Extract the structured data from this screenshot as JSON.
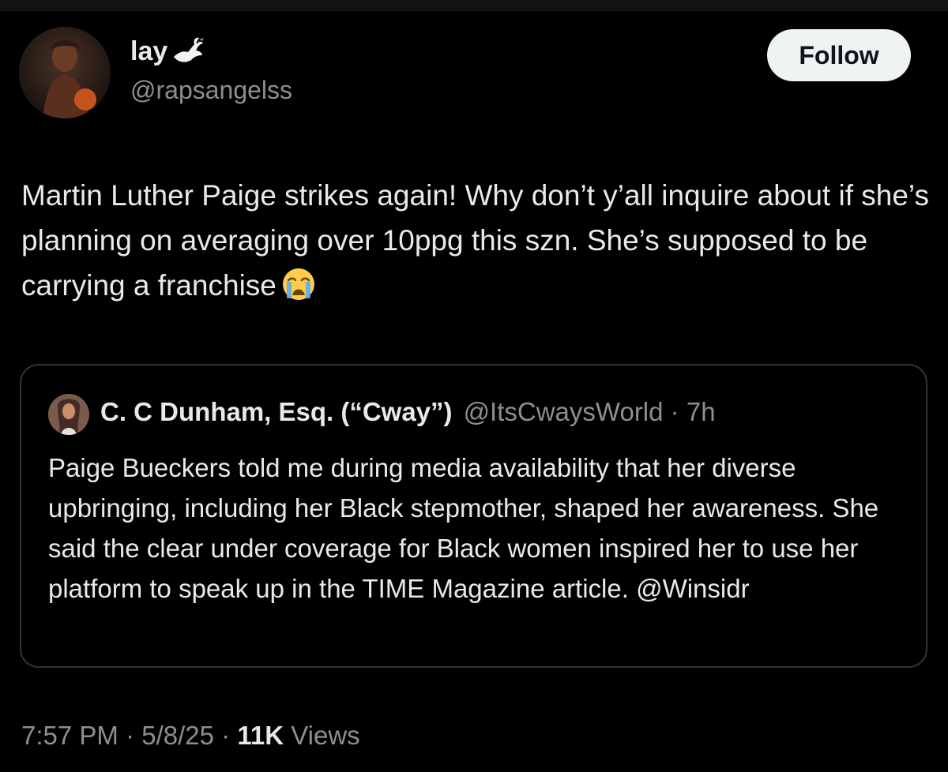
{
  "author": {
    "display_name": "lay",
    "name_icon": "dove-emoji",
    "handle": "@rapsangelss",
    "avatar_icon": "avatar-photo"
  },
  "follow_button": {
    "label": "Follow"
  },
  "tweet": {
    "text": "Martin Luther Paige strikes again! Why don’t y’all inquire about if she’s planning on averaging over 10ppg this szn. She’s supposed to be carrying a franchise",
    "trailing_emoji": "loudly-crying-face-emoji"
  },
  "quoted_tweet": {
    "display_name": "C. C Dunham, Esq. (“Cway”)",
    "handle": "@ItsCwaysWorld",
    "separator": "·",
    "time_ago": "7h",
    "text": "Paige Bueckers told me during media availability that her diverse upbringing, including her Black stepmother, shaped her awareness. She said the clear under coverage for Black women inspired her to use her platform to speak up in the TIME Magazine article. @Winsidr"
  },
  "footer": {
    "time": "7:57 PM",
    "separator": "·",
    "date": "5/8/25",
    "views_count": "11K",
    "views_label": "Views"
  },
  "colors": {
    "background": "#000000",
    "primary_text": "#e7e9ea",
    "secondary_text": "#8b8f94",
    "border": "#2f3336",
    "follow_button_bg": "#eff3f4"
  }
}
